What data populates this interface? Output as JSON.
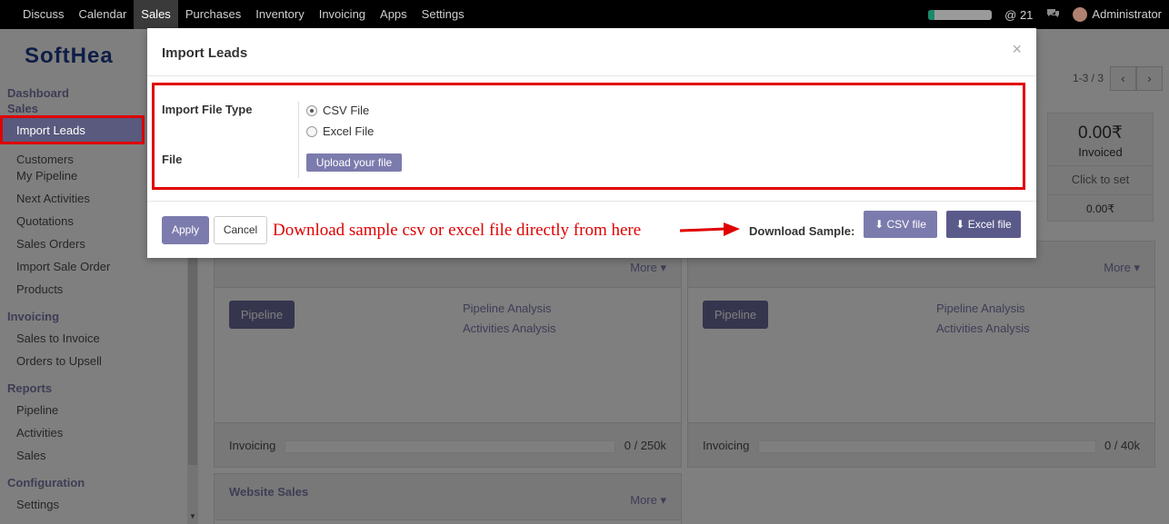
{
  "topbar": {
    "menu": [
      "Discuss",
      "Calendar",
      "Sales",
      "Purchases",
      "Inventory",
      "Invoicing",
      "Apps",
      "Settings"
    ],
    "active": "Sales",
    "notifications": "@ 21",
    "user": "Administrator",
    "progress": 0.1
  },
  "brand": {
    "logo_text": "SoftHea"
  },
  "sidebar": {
    "dashboard": "Dashboard",
    "sales_header": "Sales",
    "sales_items": [
      "Import Leads",
      "Customers",
      "My Pipeline",
      "Next Activities",
      "Quotations",
      "Sales Orders",
      "Import Sale Order",
      "Products"
    ],
    "invoicing_header": "Invoicing",
    "invoicing_items": [
      "Sales to Invoice",
      "Orders to Upsell"
    ],
    "reports_header": "Reports",
    "reports_items": [
      "Pipeline",
      "Activities",
      "Sales"
    ],
    "config_header": "Configuration",
    "config_items": [
      "Settings"
    ]
  },
  "pager": {
    "text": "1-3 / 3"
  },
  "stat": {
    "amount": "0.00₹",
    "label": "Invoiced",
    "click": "Click to set",
    "value": "0.00₹"
  },
  "cards": {
    "more": "More",
    "pipeline": "Pipeline",
    "pipeline_analysis": "Pipeline Analysis",
    "activities_analysis": "Activities Analysis",
    "invoicing": "Invoicing",
    "card1_target": "0 / 250k",
    "card2_target": "0 / 40k",
    "card3_title": "Website Sales"
  },
  "modal": {
    "title": "Import Leads",
    "close": "×",
    "file_type_label": "Import File Type",
    "options": [
      "CSV File",
      "Excel File"
    ],
    "file_label": "File",
    "upload": "Upload your file",
    "apply": "Apply",
    "cancel": "Cancel",
    "annotation": "Download sample csv or excel file directly from here",
    "download_label": "Download Sample:",
    "csv_btn": "CSV file",
    "excel_btn": "Excel file"
  }
}
